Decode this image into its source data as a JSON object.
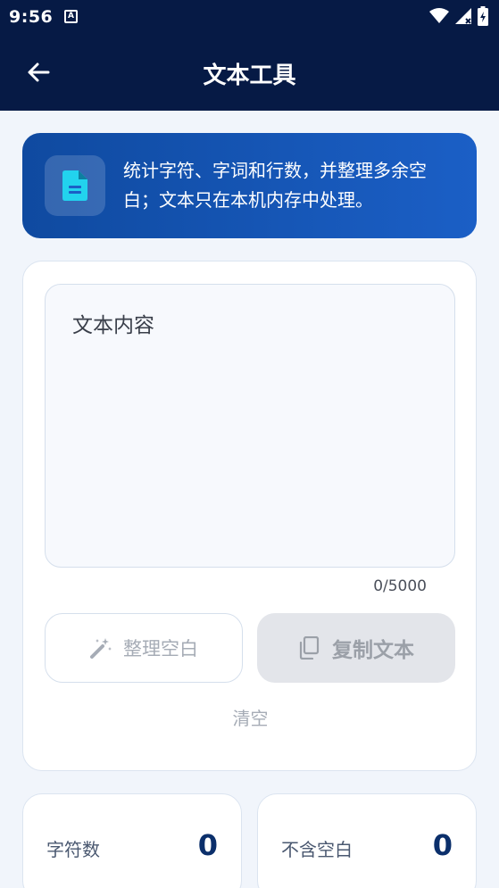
{
  "status_bar": {
    "time": "9:56",
    "notif_letter": "A"
  },
  "app_bar": {
    "title": "文本工具",
    "back_icon": "arrow-left-icon"
  },
  "info": {
    "text": "统计字符、字词和行数，并整理多余空白；文本只在本机内存中处理。",
    "icon": "document-icon"
  },
  "editor": {
    "placeholder": "文本内容",
    "counter": "0/5000"
  },
  "actions": {
    "tidy_label": "整理空白",
    "copy_label": "复制文本",
    "clear_label": "清空"
  },
  "stats": [
    {
      "label": "字符数",
      "value": "0"
    },
    {
      "label": "不含空白",
      "value": "0"
    }
  ],
  "colors": {
    "header": "#061a45",
    "accent_from": "#0f4aa0",
    "accent_to": "#1b5fc6",
    "icon_cyan": "#22d3ee",
    "value": "#0b2f6b"
  }
}
